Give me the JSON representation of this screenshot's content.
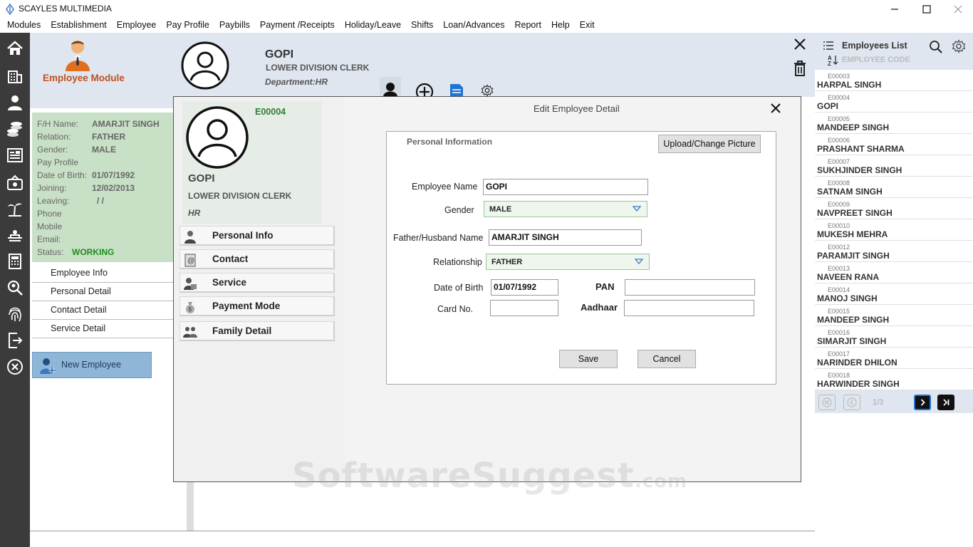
{
  "window": {
    "title": "SCAYLES MULTIMEDIA"
  },
  "menu": [
    "Modules",
    "Establishment",
    "Employee",
    "Pay Profile",
    "Paybills",
    "Payment /Receipts",
    "Holiday/Leave",
    "Shifts",
    "Loan/Advances",
    "Report",
    "Help",
    "Exit"
  ],
  "module": {
    "title": "Employee Module",
    "info": {
      "fh_name_label": "F/H Name:",
      "fh_name": "AMARJIT SINGH",
      "relation_label": "Relation:",
      "relation": "FATHER",
      "gender_label": "Gender:",
      "gender": "MALE",
      "pay_profile_label": "Pay Profile",
      "pay_profile": "",
      "dob_label": "Date of Birth:",
      "dob": "01/07/1992",
      "joining_label": "Joining:",
      "joining": "12/02/2013",
      "leaving_label": "Leaving:",
      "leaving": "/  /",
      "phone_label": "Phone",
      "phone": "",
      "mobile_label": "Mobile",
      "mobile": "",
      "email_label": "Email:",
      "email": "",
      "status_label": "Status:",
      "status": "WORKING"
    },
    "nav": [
      "Employee Info",
      "Personal Detail",
      "Contact Detail",
      "Service Detail"
    ],
    "new_employee": "New Employee"
  },
  "header": {
    "name": "GOPI",
    "designation": "LOWER DIVISION CLERK",
    "department": "Department:HR"
  },
  "dialog": {
    "title": "Edit Employee Detail",
    "emp_code": "E00004",
    "name": "GOPI",
    "designation": "LOWER DIVISION CLERK",
    "department": "HR",
    "side_buttons": [
      "Personal Info",
      "Contact",
      "Service",
      "Payment Mode",
      "Family Detail"
    ],
    "section": "Personal Information",
    "upload_button": "Upload/Change Picture",
    "form": {
      "employee_name_label": "Employee Name",
      "employee_name": "GOPI",
      "gender_label": "Gender",
      "gender": "MALE",
      "father_label": "Father/Husband Name",
      "father": "AMARJIT SINGH",
      "relationship_label": "Relationship",
      "relationship": "FATHER",
      "dob_label": "Date of Birth",
      "dob": "01/07/1992",
      "pan_label": "PAN",
      "pan": "",
      "card_label": "Card No.",
      "card": "",
      "aadhaar_label": "Aadhaar",
      "aadhaar": ""
    },
    "save": "Save",
    "cancel": "Cancel"
  },
  "employees_list": {
    "title": "Employees List",
    "sort_label": "EMPLOYEE CODE",
    "items": [
      {
        "code": "E00003",
        "name": "HARPAL SINGH"
      },
      {
        "code": "E00004",
        "name": "GOPI"
      },
      {
        "code": "E00005",
        "name": "MANDEEP SINGH"
      },
      {
        "code": "E00006",
        "name": "PRASHANT SHARMA"
      },
      {
        "code": "E00007",
        "name": "SUKHJINDER SINGH"
      },
      {
        "code": "E00008",
        "name": "SATNAM SINGH"
      },
      {
        "code": "E00009",
        "name": "NAVPREET SINGH"
      },
      {
        "code": "E00010",
        "name": "MUKESH MEHRA"
      },
      {
        "code": "E00012",
        "name": "PARAMJIT SINGH"
      },
      {
        "code": "E00013",
        "name": "NAVEEN RANA"
      },
      {
        "code": "E00014",
        "name": "MANOJ SINGH"
      },
      {
        "code": "E00015",
        "name": "MANDEEP SINGH"
      },
      {
        "code": "E00016",
        "name": "SIMARJIT SINGH"
      },
      {
        "code": "E00017",
        "name": "NARINDER DHILON"
      },
      {
        "code": "E00018",
        "name": "HARWINDER SINGH"
      }
    ],
    "page": "1/3"
  },
  "watermark": {
    "main": "SoftwareSuggest",
    "suffix": ".com"
  }
}
